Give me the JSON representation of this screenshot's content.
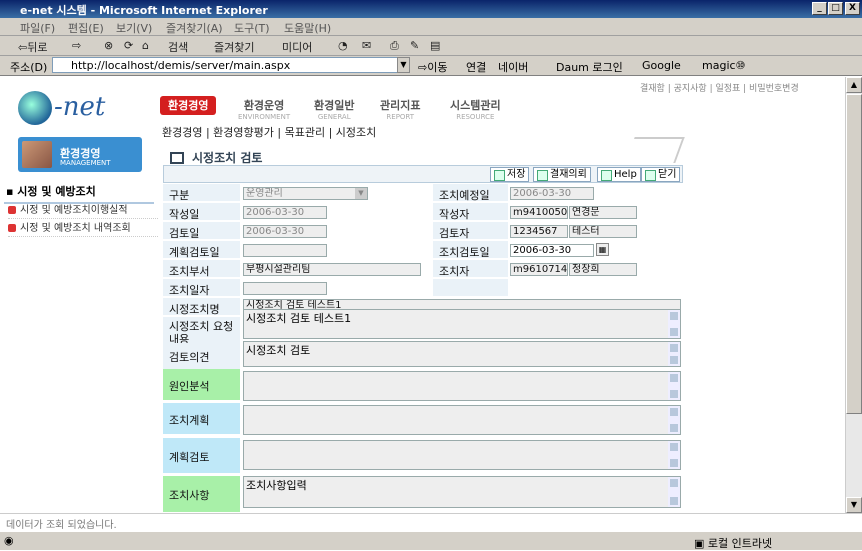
{
  "window": {
    "title": "e-net 시스템 - Microsoft Internet Explorer",
    "min": "_",
    "max": "□",
    "close": "X"
  },
  "menu": [
    "파일(F)",
    "편집(E)",
    "보기(V)",
    "즐겨찾기(A)",
    "도구(T)",
    "도움말(H)"
  ],
  "toolbar": {
    "back": "⇦뒤로",
    "fwd": "⇨",
    "search": "검색",
    "favorites": "즐겨찾기",
    "media": "미디어"
  },
  "address": {
    "label": "주소(D)",
    "url": "http://localhost/demis/server/main.aspx",
    "go": "이동",
    "links": "연결",
    "link1": "네이버",
    "link2": "Daum 로그인",
    "link3": "Google",
    "link4": "magic⑩"
  },
  "app": {
    "logo": "-net",
    "toplinks": "결재함 | 공지사항 | 일정표 | 비밀번호변경",
    "nav": [
      {
        "label": "환경경영",
        "sub": ""
      },
      {
        "label": "환경운영",
        "sub": "ENVIRONMENT"
      },
      {
        "label": "환경일반",
        "sub": "GENERAL"
      },
      {
        "label": "관리지표",
        "sub": "REPORT"
      },
      {
        "label": "시스템관리",
        "sub": "RESOURCE"
      }
    ],
    "breadcrumb": "환경경영 | 환경영향평가 | 목표관리 | 시정조치",
    "side_banner": {
      "title": "환경경영",
      "sub": "MANAGEMENT"
    },
    "side_head": "시정 및 예방조치",
    "side_items": [
      "시정 및 예방조치이행실적",
      "시정 및 예방조치 내역조회"
    ],
    "page_title": "시정조치 검토",
    "buttons": [
      "저장",
      "결재의뢰",
      "Help",
      "닫기"
    ],
    "form": {
      "lbl_type": "구분",
      "val_type": "운영관리",
      "lbl_plan_date": "조치예정일",
      "val_plan_date": "2006-03-30",
      "lbl_write_date": "작성일",
      "val_write_date": "2006-03-30",
      "lbl_writer": "작성자",
      "val_writer_id": "m9410050",
      "val_writer_name": "연경문",
      "lbl_review_date": "검토일",
      "val_review_date": "2006-03-30",
      "lbl_reviewer": "검토자",
      "val_reviewer_id": "1234567",
      "val_reviewer_name": "테스터",
      "lbl_plan_review": "계획검토일",
      "lbl_action_review": "조치검토일",
      "val_action_review": "2006-03-30",
      "lbl_dept": "조치부서",
      "val_dept": "부평시설관리팀",
      "lbl_actor": "조치자",
      "val_actor_id": "m9610714",
      "val_actor_name": "정창희",
      "lbl_action_date": "조치일자",
      "lbl_action_name": "시정조치명",
      "val_action_name": "시정조치 검토 테스트1",
      "lbl_request": "시정조치 요청내용",
      "val_request": "시정조치 검토 테스트1",
      "lbl_opinion": "검토의견",
      "val_opinion": "시정조치 검토",
      "lbl_cause": "원인분석",
      "lbl_plan": "조치계획",
      "lbl_plan_rev": "계획검토",
      "lbl_result": "조치사항",
      "val_result": "조치사항입력"
    }
  },
  "status": "데이터가 조회 되었습니다.",
  "ie_status": "로컬 인트라넷"
}
